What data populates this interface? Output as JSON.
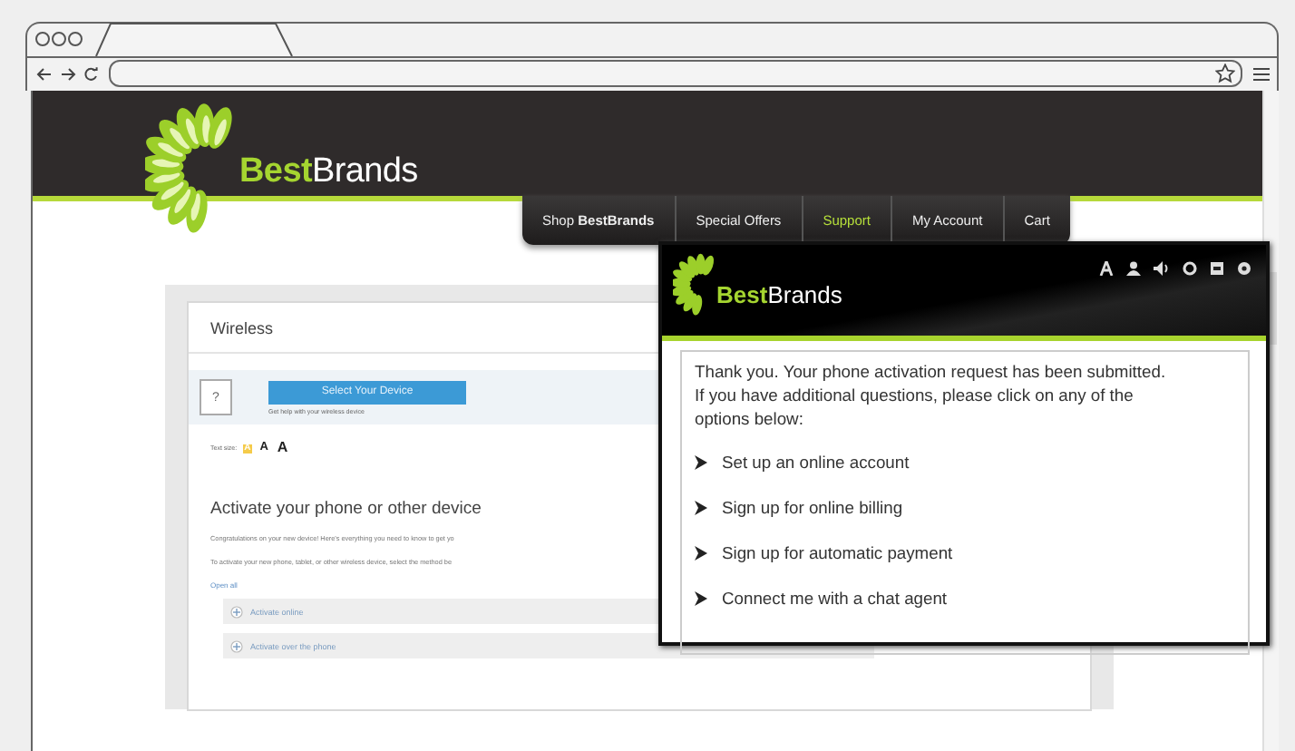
{
  "logo": {
    "part_1": "Best",
    "part_2": "Brands"
  },
  "nav": [
    {
      "label": "Shop **BestBrands**",
      "selected": false
    },
    {
      "label": "Special Offers",
      "selected": false
    },
    {
      "label": "Support",
      "selected": true
    },
    {
      "label": "My Account",
      "selected": false
    },
    {
      "label": "Cart",
      "selected": false
    }
  ],
  "card": {
    "title": "Wireless",
    "help_glyph": "?",
    "device_button": "Select Your Device",
    "device_hint": "Get help with your wireless device",
    "text_size": {
      "label": "Text size:",
      "options": [
        {
          "label": "A",
          "selected": true
        },
        {
          "label": "A",
          "selected": false
        },
        {
          "label": "A",
          "selected": false
        }
      ]
    },
    "heading": "Activate your phone or other device",
    "paragraphs": [
      "Congratulations on your new device! Here's everything you need to know to get yo",
      "To activate your new phone, tablet, or other wireless device, select the method be"
    ],
    "open_all": "Open all",
    "sections": [
      {
        "label": "Activate online",
        "expanded": false
      },
      {
        "label": "Activate over the phone",
        "expanded": false
      }
    ]
  },
  "popup": {
    "logo": {
      "part_1": "Best",
      "part_2": "Brands"
    },
    "message": "Thank you. Your phone activation request has been submitted.  If you have additional questions, please click on any of the options below:",
    "options": [
      "Set up an online account",
      "Sign up for online billing",
      "Sign up for automatic payment",
      "Connect me with a chat agent"
    ]
  }
}
